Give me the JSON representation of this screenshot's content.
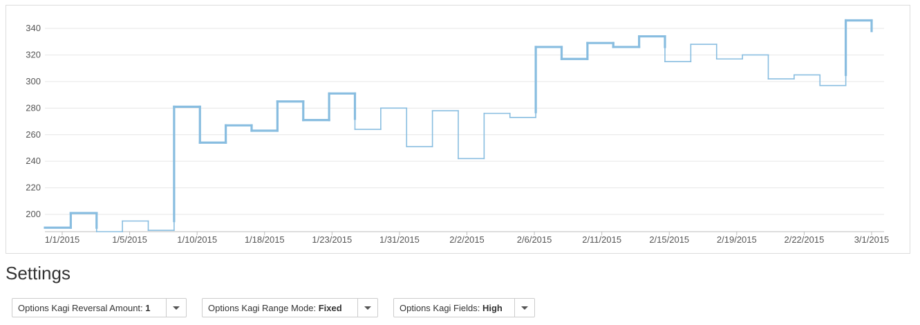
{
  "chart_data": {
    "type": "kagi",
    "x_tick_labels": [
      "1/1/2015",
      "1/5/2015",
      "1/10/2015",
      "1/18/2015",
      "1/23/2015",
      "1/31/2015",
      "2/2/2015",
      "2/6/2015",
      "2/11/2015",
      "2/15/2015",
      "2/19/2015",
      "2/22/2015",
      "3/1/2015"
    ],
    "y_tick_labels": [
      "200",
      "220",
      "240",
      "260",
      "280",
      "300",
      "320",
      "340"
    ],
    "ylim": [
      187,
      352
    ],
    "grid": true,
    "line_color": "#88bde0",
    "path": [
      {
        "x": 0,
        "y": 190,
        "w": "thick"
      },
      {
        "x": 1,
        "y": 190,
        "w": "thick"
      },
      {
        "x": 1,
        "y": 201,
        "w": "thick"
      },
      {
        "x": 2,
        "y": 201,
        "w": "thick"
      },
      {
        "x": 2,
        "y": 190,
        "w": "thick"
      },
      {
        "x": 2,
        "y": 187,
        "w": "thin"
      },
      {
        "x": 3,
        "y": 187,
        "w": "thin"
      },
      {
        "x": 3,
        "y": 195,
        "w": "thin"
      },
      {
        "x": 4,
        "y": 195,
        "w": "thin"
      },
      {
        "x": 4,
        "y": 188,
        "w": "thin"
      },
      {
        "x": 5,
        "y": 188,
        "w": "thin"
      },
      {
        "x": 5,
        "y": 195,
        "w": "thin"
      },
      {
        "x": 5,
        "y": 281,
        "w": "thick"
      },
      {
        "x": 6,
        "y": 281,
        "w": "thick"
      },
      {
        "x": 6,
        "y": 254,
        "w": "thick"
      },
      {
        "x": 7,
        "y": 254,
        "w": "thick"
      },
      {
        "x": 7,
        "y": 267,
        "w": "thick"
      },
      {
        "x": 8,
        "y": 267,
        "w": "thick"
      },
      {
        "x": 8,
        "y": 263,
        "w": "thick"
      },
      {
        "x": 9,
        "y": 263,
        "w": "thick"
      },
      {
        "x": 9,
        "y": 285,
        "w": "thick"
      },
      {
        "x": 10,
        "y": 285,
        "w": "thick"
      },
      {
        "x": 10,
        "y": 271,
        "w": "thick"
      },
      {
        "x": 11,
        "y": 271,
        "w": "thick"
      },
      {
        "x": 11,
        "y": 291,
        "w": "thick"
      },
      {
        "x": 12,
        "y": 291,
        "w": "thick"
      },
      {
        "x": 12,
        "y": 272,
        "w": "thick"
      },
      {
        "x": 12,
        "y": 264,
        "w": "thin"
      },
      {
        "x": 13,
        "y": 264,
        "w": "thin"
      },
      {
        "x": 13,
        "y": 280,
        "w": "thin"
      },
      {
        "x": 14,
        "y": 280,
        "w": "thin"
      },
      {
        "x": 14,
        "y": 251,
        "w": "thin"
      },
      {
        "x": 15,
        "y": 251,
        "w": "thin"
      },
      {
        "x": 15,
        "y": 278,
        "w": "thin"
      },
      {
        "x": 16,
        "y": 278,
        "w": "thin"
      },
      {
        "x": 16,
        "y": 242,
        "w": "thin"
      },
      {
        "x": 17,
        "y": 242,
        "w": "thin"
      },
      {
        "x": 17,
        "y": 276,
        "w": "thin"
      },
      {
        "x": 18,
        "y": 276,
        "w": "thin"
      },
      {
        "x": 18,
        "y": 273,
        "w": "thin"
      },
      {
        "x": 19,
        "y": 273,
        "w": "thin"
      },
      {
        "x": 19,
        "y": 277,
        "w": "thin"
      },
      {
        "x": 19,
        "y": 326,
        "w": "thick"
      },
      {
        "x": 20,
        "y": 326,
        "w": "thick"
      },
      {
        "x": 20,
        "y": 317,
        "w": "thick"
      },
      {
        "x": 21,
        "y": 317,
        "w": "thick"
      },
      {
        "x": 21,
        "y": 329,
        "w": "thick"
      },
      {
        "x": 22,
        "y": 329,
        "w": "thick"
      },
      {
        "x": 22,
        "y": 326,
        "w": "thick"
      },
      {
        "x": 23,
        "y": 326,
        "w": "thick"
      },
      {
        "x": 23,
        "y": 334,
        "w": "thick"
      },
      {
        "x": 24,
        "y": 334,
        "w": "thick"
      },
      {
        "x": 24,
        "y": 326,
        "w": "thick"
      },
      {
        "x": 24,
        "y": 315,
        "w": "thin"
      },
      {
        "x": 25,
        "y": 315,
        "w": "thin"
      },
      {
        "x": 25,
        "y": 328,
        "w": "thin"
      },
      {
        "x": 26,
        "y": 328,
        "w": "thin"
      },
      {
        "x": 26,
        "y": 317,
        "w": "thin"
      },
      {
        "x": 27,
        "y": 317,
        "w": "thin"
      },
      {
        "x": 27,
        "y": 320,
        "w": "thin"
      },
      {
        "x": 28,
        "y": 320,
        "w": "thin"
      },
      {
        "x": 28,
        "y": 302,
        "w": "thin"
      },
      {
        "x": 29,
        "y": 302,
        "w": "thin"
      },
      {
        "x": 29,
        "y": 305,
        "w": "thin"
      },
      {
        "x": 30,
        "y": 305,
        "w": "thin"
      },
      {
        "x": 30,
        "y": 297,
        "w": "thin"
      },
      {
        "x": 31,
        "y": 297,
        "w": "thin"
      },
      {
        "x": 31,
        "y": 305,
        "w": "thin"
      },
      {
        "x": 31,
        "y": 346,
        "w": "thick"
      },
      {
        "x": 32,
        "y": 346,
        "w": "thick"
      },
      {
        "x": 32,
        "y": 338,
        "w": "thick"
      }
    ]
  },
  "settings": {
    "title": "Settings",
    "options": [
      {
        "label": "Options Kagi Reversal Amount: ",
        "value": "1"
      },
      {
        "label": "Options Kagi Range Mode: ",
        "value": "Fixed"
      },
      {
        "label": "Options Kagi Fields: ",
        "value": "High"
      }
    ]
  }
}
